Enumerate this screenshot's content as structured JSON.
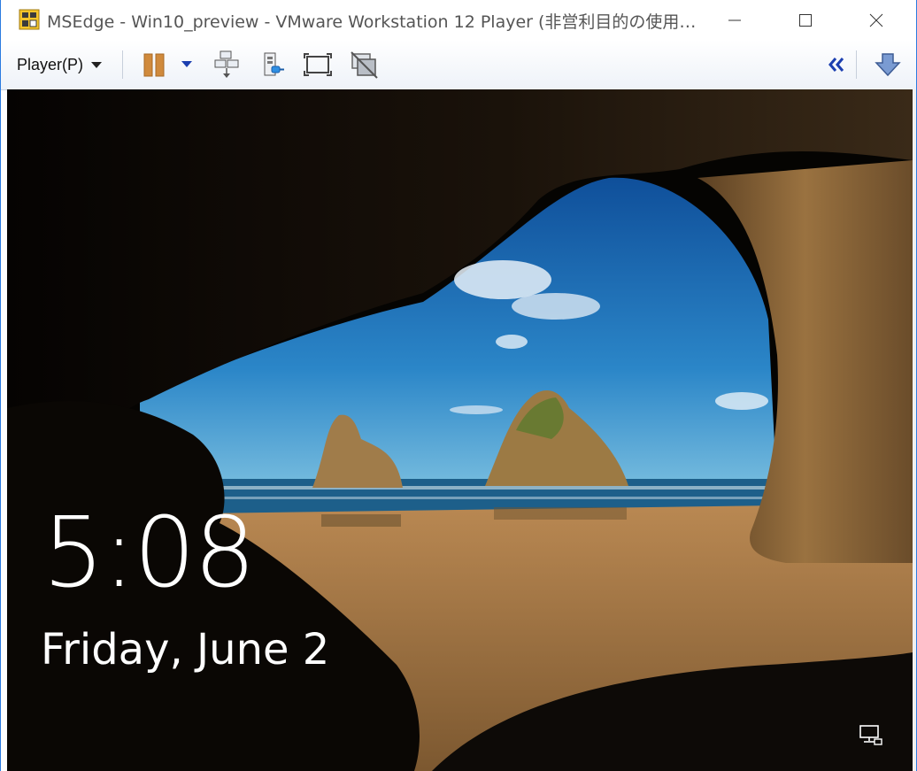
{
  "window": {
    "title": "MSEdge - Win10_preview - VMware Workstation 12 Player (非営利目的の使用…",
    "controls": [
      "minimize-icon",
      "maximize-icon",
      "close-icon"
    ]
  },
  "toolbar": {
    "player_menu_label": "Player(P)",
    "icons": [
      "pause-icon",
      "dropdown-arrow-icon",
      "send-ctrl-alt-del-icon",
      "removable-devices-icon",
      "fullscreen-icon",
      "unity-icon",
      "collapse-toolbar-icon",
      "download-icon"
    ]
  },
  "lock_screen": {
    "time": "5:08",
    "date": "Friday, June 2",
    "status_icon": "network-icon"
  },
  "colors": {
    "accent": "#1565c0",
    "pause": "#d08a3c",
    "sky": "#1a6fb8",
    "sand": "#a87a43"
  }
}
